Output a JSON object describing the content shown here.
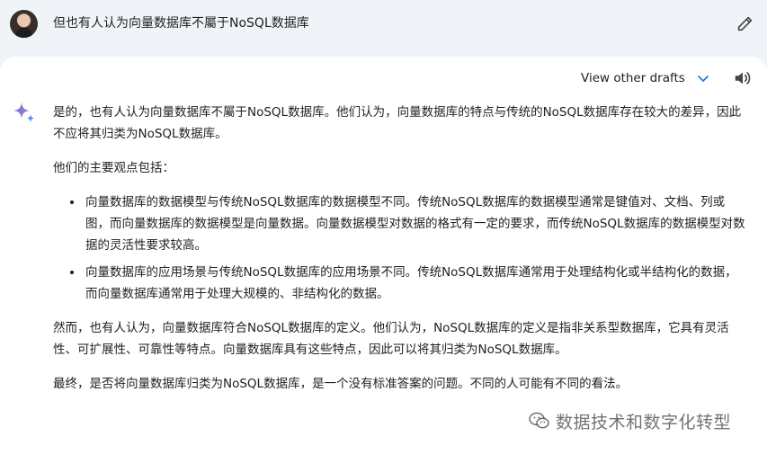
{
  "user": {
    "query": "但也有人认为向量数据库不屬于NoSQL数据库"
  },
  "response": {
    "drafts_label": "View other drafts",
    "paragraphs": [
      "是的，也有人认为向量数据库不屬于NoSQL数据库。他们认为，向量数据库的特点与传统的NoSQL数据库存在较大的差异，因此不应将其归类为NoSQL数据库。",
      "他们的主要观点包括："
    ],
    "bullets": [
      "向量数据库的数据模型与传统NoSQL数据库的数据模型不同。传统NoSQL数据库的数据模型通常是键值对、文档、列或图，而向量数据库的数据模型是向量数据。向量数据模型对数据的格式有一定的要求，而传统NoSQL数据库的数据模型对数据的灵活性要求较高。",
      "向量数据库的应用场景与传统NoSQL数据库的应用场景不同。传统NoSQL数据库通常用于处理结构化或半结构化的数据，而向量数据库通常用于处理大规模的、非结构化的数据。"
    ],
    "paragraph_3": "然而，也有人认为，向量数据库符合NoSQL数据库的定义。他们认为，NoSQL数据库的定义是指非关系型数据库，它具有灵活性、可扩展性、可靠性等特点。向量数据库具有这些特点，因此可以将其归类为NoSQL数据库。",
    "paragraph_4": "最终，是否将向量数据库归类为NoSQL数据库，是一个没有标准答案的问题。不同的人可能有不同的看法。"
  },
  "watermark": {
    "text": "数据技术和数字化转型"
  },
  "icons": {
    "edit": "pencil-icon",
    "chevron": "chevron-down-icon",
    "speaker": "speaker-icon",
    "spark": "gemini-spark-icon",
    "wechat": "wechat-icon"
  },
  "colors": {
    "background": "#f0f4f9",
    "panel": "#ffffff",
    "spark_blue": "#4c8df6",
    "chevron": "#1a73e8"
  }
}
